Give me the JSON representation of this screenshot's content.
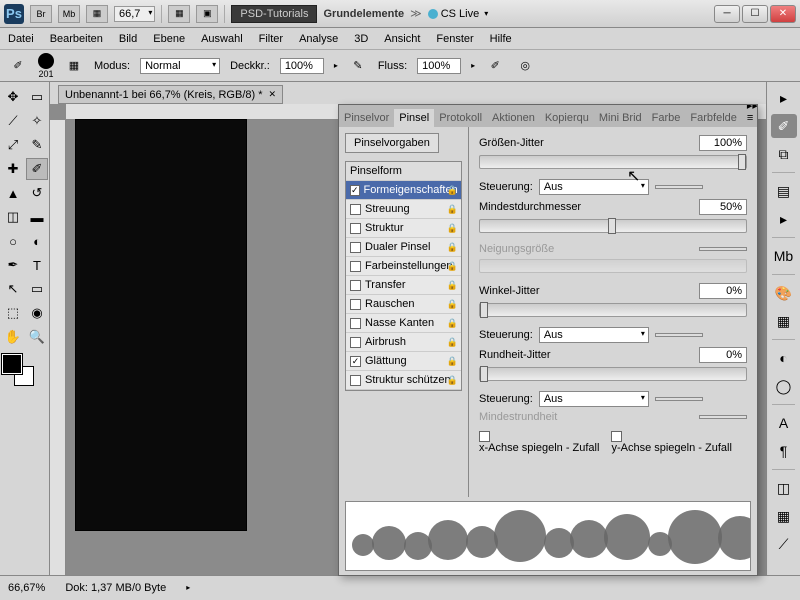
{
  "titlebar": {
    "zoom": "66,7",
    "psd_tut": "PSD-Tutorials",
    "grund": "Grundelemente",
    "cslive": "CS Live"
  },
  "menu": [
    "Datei",
    "Bearbeiten",
    "Bild",
    "Ebene",
    "Auswahl",
    "Filter",
    "Analyse",
    "3D",
    "Ansicht",
    "Fenster",
    "Hilfe"
  ],
  "optbar": {
    "brush_size": "201",
    "modus_lbl": "Modus:",
    "modus_val": "Normal",
    "deck_lbl": "Deckkr.:",
    "deck_val": "100%",
    "fluss_lbl": "Fluss:",
    "fluss_val": "100%"
  },
  "doc_tab": "Unbenannt-1 bei 66,7% (Kreis, RGB/8) *",
  "panel": {
    "tabs": [
      "Pinselvor",
      "Pinsel",
      "Protokoll",
      "Aktionen",
      "Kopierqu",
      "Mini Brid",
      "Farbe",
      "Farbfelde"
    ],
    "active_tab": 1,
    "preset_btn": "Pinselvorgaben",
    "list_header": "Pinselform",
    "items": [
      {
        "label": "Formeigenschaften",
        "checked": true,
        "selected": true,
        "lock": true
      },
      {
        "label": "Streuung",
        "checked": false,
        "lock": true
      },
      {
        "label": "Struktur",
        "checked": false,
        "lock": true
      },
      {
        "label": "Dualer Pinsel",
        "checked": false,
        "lock": true
      },
      {
        "label": "Farbeinstellungen",
        "checked": false,
        "lock": true
      },
      {
        "label": "Transfer",
        "checked": false,
        "lock": true
      },
      {
        "label": "Rauschen",
        "checked": false,
        "lock": true
      },
      {
        "label": "Nasse Kanten",
        "checked": false,
        "lock": true
      },
      {
        "label": "Airbrush",
        "checked": false,
        "lock": true
      },
      {
        "label": "Glättung",
        "checked": true,
        "lock": true
      },
      {
        "label": "Struktur schützen",
        "checked": false,
        "lock": true
      }
    ],
    "groessen_lbl": "Größen-Jitter",
    "groessen_val": "100%",
    "steuerung_lbl": "Steuerung:",
    "steuerung_val": "Aus",
    "mindest_lbl": "Mindestdurchmesser",
    "mindest_val": "50%",
    "neigung_lbl": "Neigungsgröße",
    "winkel_lbl": "Winkel-Jitter",
    "winkel_val": "0%",
    "rund_lbl": "Rundheit-Jitter",
    "rund_val": "0%",
    "mindrund_lbl": "Mindestrundheit",
    "xachse": "x-Achse spiegeln - Zufall",
    "yachse": "y-Achse spiegeln - Zufall"
  },
  "status": {
    "zoom": "66,67%",
    "dok": "Dok: 1,37 MB/0 Byte"
  }
}
